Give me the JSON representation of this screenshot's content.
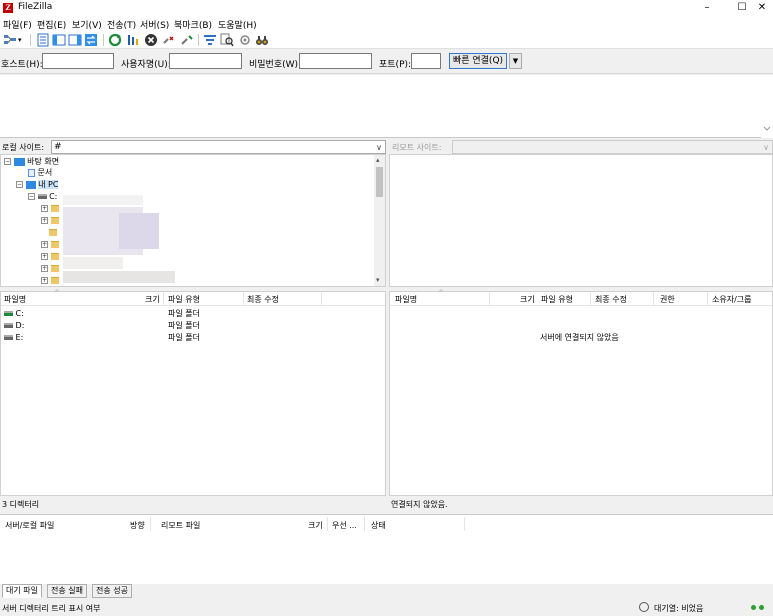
{
  "window": {
    "title": "FileZilla",
    "minimize": "–",
    "maximize": "☐",
    "close": "✕",
    "logo": "Z"
  },
  "menu": [
    "파일(F)",
    "편집(E)",
    "보기(V)",
    "전송(T)",
    "서버(S)",
    "북마크(B)",
    "도움말(H)"
  ],
  "quickconnect": {
    "host_label": "호스트(H):",
    "host_value": "",
    "user_label": "사용자명(U):",
    "user_value": "",
    "pass_label": "비밀번호(W):",
    "pass_value": "",
    "port_label": "포트(P):",
    "port_value": "",
    "connect_button": "빠른 연결(Q)",
    "dropdown_icon": "▼"
  },
  "local_site": {
    "label": "로컬 사이트:",
    "path": "#",
    "tree": {
      "desktop": "바탕 화면",
      "documents": "문서",
      "mypc": "내 PC",
      "drive_c": "C:"
    }
  },
  "remote_site": {
    "label": "리모트 사이트:",
    "path": ""
  },
  "local_list": {
    "columns": [
      "파일명",
      "크기",
      "파일 유형",
      "최종 수정"
    ],
    "rows": [
      {
        "name": "C:",
        "size": "",
        "type": "파일 폴더",
        "modified": "",
        "icon": "drive-icon"
      },
      {
        "name": "D:",
        "size": "",
        "type": "파일 폴더",
        "modified": "",
        "icon": "drive-icon"
      },
      {
        "name": "E:",
        "size": "",
        "type": "파일 폴더",
        "modified": "",
        "icon": "drive-icon"
      }
    ],
    "status": "3 디렉터리"
  },
  "remote_list": {
    "columns": [
      "파일명",
      "크기",
      "파일 유형",
      "최종 수정",
      "권한",
      "소유자/그룹"
    ],
    "empty_message": "서버에 연결되지 않았음",
    "status": "연결되지 않았음."
  },
  "queue": {
    "columns": [
      "서버/로컬 파일",
      "방향",
      "리모트 파일",
      "크기",
      "우선 ...",
      "상태"
    ]
  },
  "tabs": [
    {
      "label": "대기 파일",
      "active": true
    },
    {
      "label": "전송 실패",
      "active": false
    },
    {
      "label": "전송 성공",
      "active": false
    }
  ],
  "statusbar": {
    "text": "서버 디렉터리 트리 표시 여부",
    "queue": "대기열: 비었음"
  },
  "colors": {
    "accent": "#3078d0",
    "logo": "#bf0000",
    "led_green": "#2e9e2e",
    "led_red": "#c01010"
  }
}
